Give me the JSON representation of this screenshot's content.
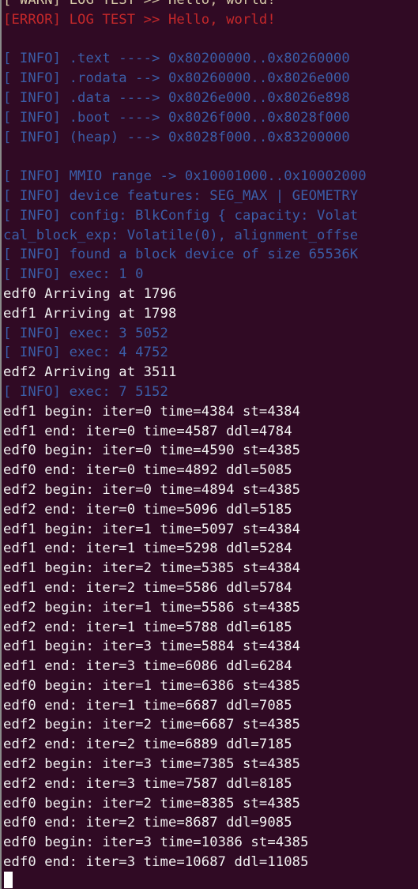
{
  "terminal": {
    "colors": {
      "background": "#300a24",
      "warn": "#d6c9a8",
      "error": "#c4282a",
      "info": "#3b5ea8",
      "output": "#f2f2f2"
    },
    "lines": [
      {
        "kind": "warn",
        "text": "[ WARN] LOG TEST >> Hello, world!"
      },
      {
        "kind": "error",
        "text": "[ERROR] LOG TEST >> Hello, world!"
      },
      {
        "kind": "blank",
        "text": " "
      },
      {
        "kind": "info",
        "text": "[ INFO] .text ----> 0x80200000..0x80260000"
      },
      {
        "kind": "info",
        "text": "[ INFO] .rodata --> 0x80260000..0x8026e000"
      },
      {
        "kind": "info",
        "text": "[ INFO] .data ----> 0x8026e000..0x8026e898"
      },
      {
        "kind": "info",
        "text": "[ INFO] .boot ----> 0x8026f000..0x8028f000"
      },
      {
        "kind": "info",
        "text": "[ INFO] (heap) ---> 0x8028f000..0x83200000"
      },
      {
        "kind": "blank",
        "text": " "
      },
      {
        "kind": "info",
        "text": "[ INFO] MMIO range -> 0x10001000..0x10002000"
      },
      {
        "kind": "info",
        "text": "[ INFO] device features: SEG_MAX | GEOMETRY"
      },
      {
        "kind": "info",
        "text": "[ INFO] config: BlkConfig { capacity: Volat"
      },
      {
        "kind": "info",
        "text": "cal_block_exp: Volatile(0), alignment_offse"
      },
      {
        "kind": "info",
        "text": "[ INFO] found a block device of size 65536K"
      },
      {
        "kind": "info",
        "text": "[ INFO] exec: 1 0"
      },
      {
        "kind": "out",
        "text": "edf0 Arriving at 1796"
      },
      {
        "kind": "out",
        "text": "edf1 Arriving at 1798"
      },
      {
        "kind": "info",
        "text": "[ INFO] exec: 3 5052"
      },
      {
        "kind": "info",
        "text": "[ INFO] exec: 4 4752"
      },
      {
        "kind": "out",
        "text": "edf2 Arriving at 3511"
      },
      {
        "kind": "info",
        "text": "[ INFO] exec: 7 5152"
      },
      {
        "kind": "out",
        "text": "edf1 begin: iter=0 time=4384 st=4384"
      },
      {
        "kind": "out",
        "text": "edf1 end: iter=0 time=4587 ddl=4784"
      },
      {
        "kind": "out",
        "text": "edf0 begin: iter=0 time=4590 st=4385"
      },
      {
        "kind": "out",
        "text": "edf0 end: iter=0 time=4892 ddl=5085"
      },
      {
        "kind": "out",
        "text": "edf2 begin: iter=0 time=4894 st=4385"
      },
      {
        "kind": "out",
        "text": "edf2 end: iter=0 time=5096 ddl=5185"
      },
      {
        "kind": "out",
        "text": "edf1 begin: iter=1 time=5097 st=4384"
      },
      {
        "kind": "out",
        "text": "edf1 end: iter=1 time=5298 ddl=5284"
      },
      {
        "kind": "out",
        "text": "edf1 begin: iter=2 time=5385 st=4384"
      },
      {
        "kind": "out",
        "text": "edf1 end: iter=2 time=5586 ddl=5784"
      },
      {
        "kind": "out",
        "text": "edf2 begin: iter=1 time=5586 st=4385"
      },
      {
        "kind": "out",
        "text": "edf2 end: iter=1 time=5788 ddl=6185"
      },
      {
        "kind": "out",
        "text": "edf1 begin: iter=3 time=5884 st=4384"
      },
      {
        "kind": "out",
        "text": "edf1 end: iter=3 time=6086 ddl=6284"
      },
      {
        "kind": "out",
        "text": "edf0 begin: iter=1 time=6386 st=4385"
      },
      {
        "kind": "out",
        "text": "edf0 end: iter=1 time=6687 ddl=7085"
      },
      {
        "kind": "out",
        "text": "edf2 begin: iter=2 time=6687 st=4385"
      },
      {
        "kind": "out",
        "text": "edf2 end: iter=2 time=6889 ddl=7185"
      },
      {
        "kind": "out",
        "text": "edf2 begin: iter=3 time=7385 st=4385"
      },
      {
        "kind": "out",
        "text": "edf2 end: iter=3 time=7587 ddl=8185"
      },
      {
        "kind": "out",
        "text": "edf0 begin: iter=2 time=8385 st=4385"
      },
      {
        "kind": "out",
        "text": "edf0 end: iter=2 time=8687 ddl=9085"
      },
      {
        "kind": "out",
        "text": "edf0 begin: iter=3 time=10386 st=4385"
      },
      {
        "kind": "out",
        "text": "edf0 end: iter=3 time=10687 ddl=11085"
      }
    ]
  }
}
